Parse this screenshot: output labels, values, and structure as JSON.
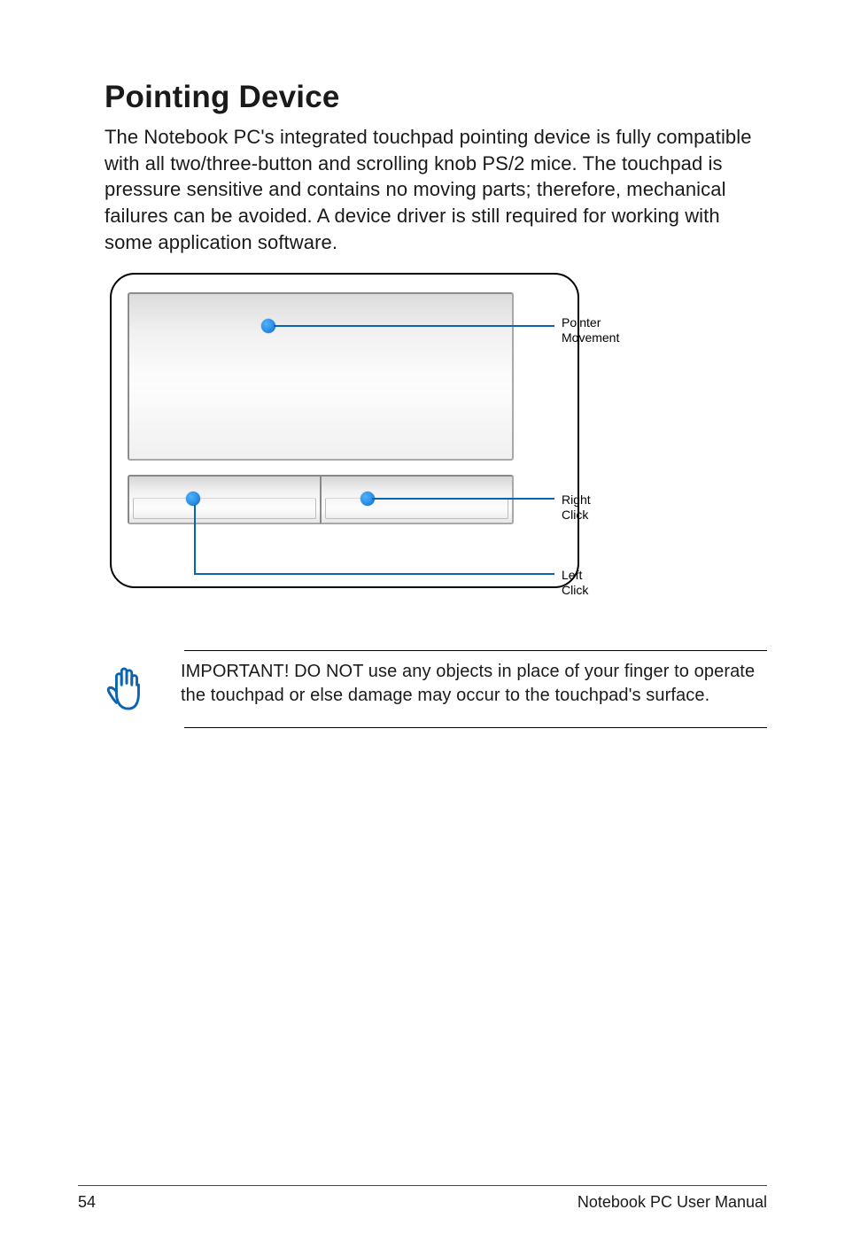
{
  "title": "Pointing Device",
  "paragraph": "The Notebook PC's integrated touchpad pointing device is fully compatible with all two/three-button and scrolling knob PS/2 mice. The touchpad is pressure sensitive and contains no moving parts; therefore, mechanical failures can be avoided. A device driver is still required for working with some application software.",
  "diagram": {
    "labels": {
      "pointer_movement_line1": "Pointer",
      "pointer_movement_line2": "Movement",
      "right_click": "Right Click",
      "left_click": "Left Click"
    }
  },
  "note": "IMPORTANT! DO NOT use any objects in place of your finger to operate the touchpad or else damage may occur to the touchpad's surface.",
  "footer": {
    "page": "54",
    "title": "Notebook PC User Manual"
  }
}
